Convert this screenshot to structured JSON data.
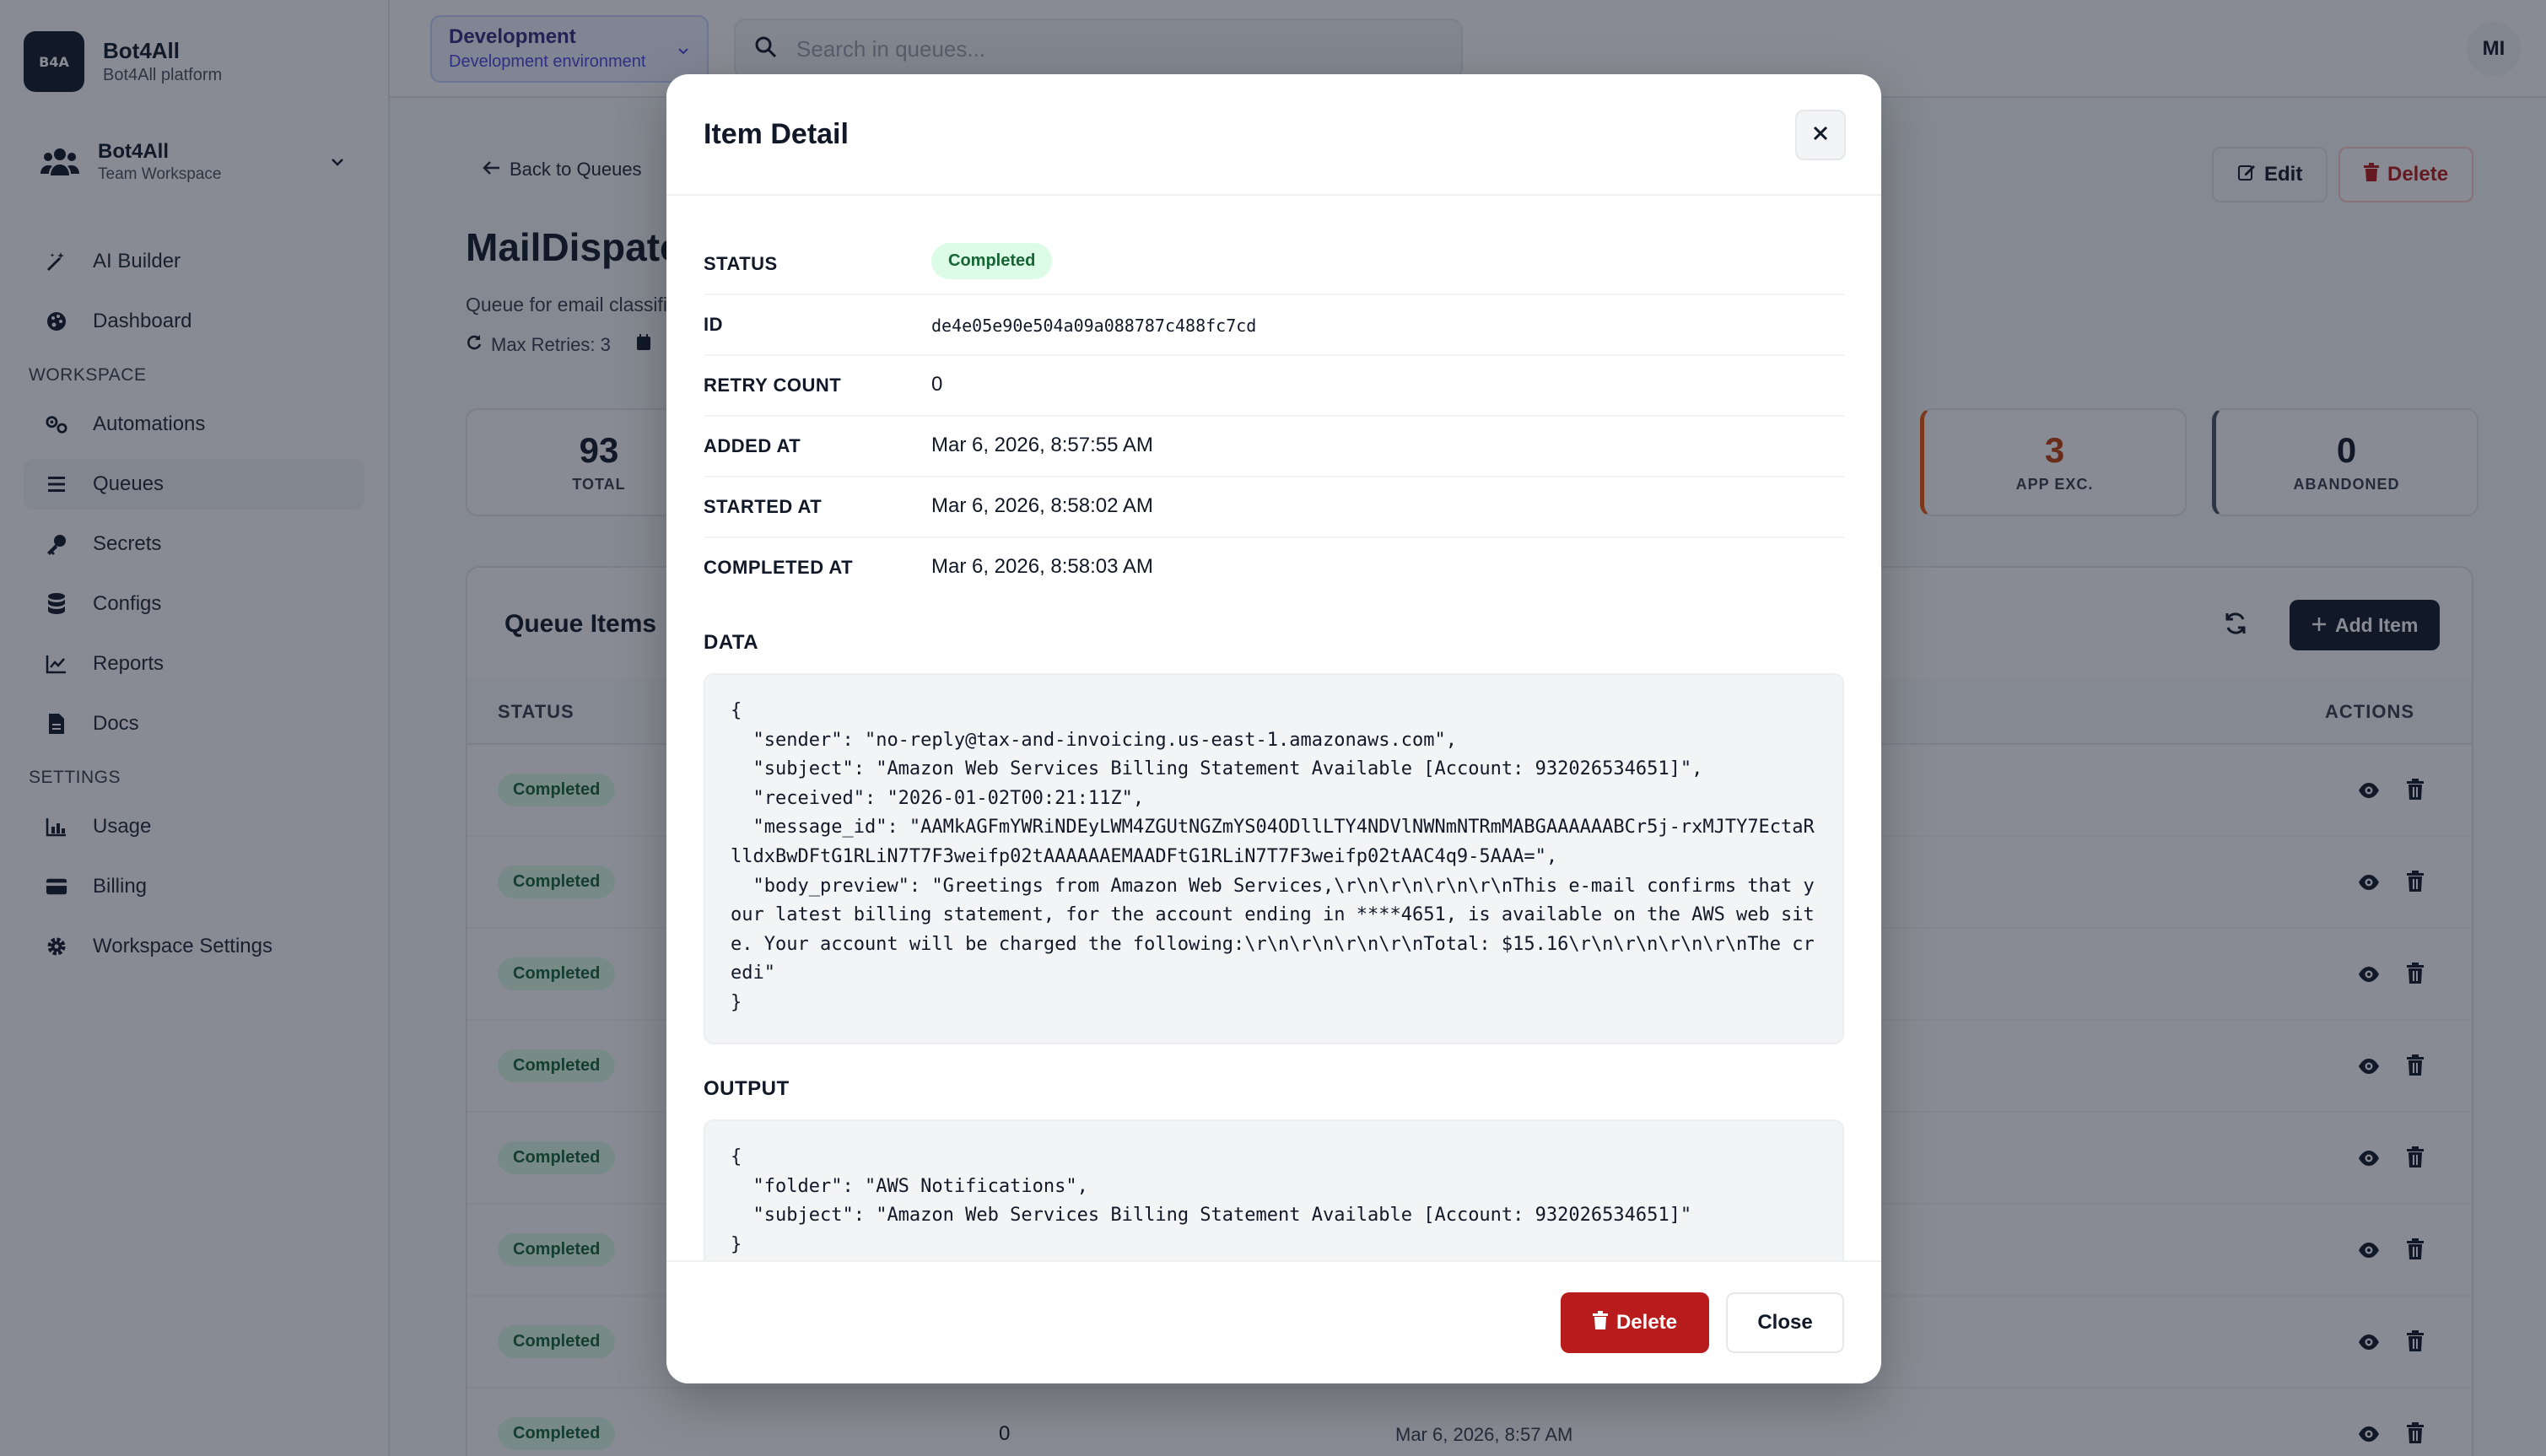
{
  "brand": {
    "logo": "B4A",
    "name": "Bot4All",
    "subtitle": "Bot4All platform"
  },
  "team": {
    "name": "Bot4All",
    "subtitle": "Team Workspace"
  },
  "nav": {
    "top": [
      {
        "label": "AI Builder",
        "icon": "wand-icon"
      },
      {
        "label": "Dashboard",
        "icon": "palette-icon"
      }
    ],
    "workspace_label": "WORKSPACE",
    "workspace": [
      {
        "label": "Automations",
        "icon": "cogs-icon"
      },
      {
        "label": "Queues",
        "icon": "list-icon"
      },
      {
        "label": "Secrets",
        "icon": "key-icon"
      },
      {
        "label": "Configs",
        "icon": "database-icon"
      },
      {
        "label": "Reports",
        "icon": "chart-icon"
      },
      {
        "label": "Docs",
        "icon": "file-icon"
      }
    ],
    "settings_label": "SETTINGS",
    "settings": [
      {
        "label": "Usage",
        "icon": "bar-chart-icon"
      },
      {
        "label": "Billing",
        "icon": "card-icon"
      },
      {
        "label": "Workspace Settings",
        "icon": "gear-icon"
      }
    ]
  },
  "topbar": {
    "env_name": "Development",
    "env_sub": "Development environment",
    "search_placeholder": "Search in queues...",
    "avatar": "MI"
  },
  "page": {
    "back": "Back to Queues",
    "title": "MailDispatcher",
    "description": "Queue for email classification",
    "max_retries": "Max Retries: 3",
    "edit": "Edit",
    "delete": "Delete"
  },
  "stats": [
    {
      "value": "93",
      "label": "TOTAL"
    },
    {
      "value": "3",
      "label": "APP EXC.",
      "color": "#c2410c"
    },
    {
      "value": "0",
      "label": "ABANDONED"
    }
  ],
  "queue": {
    "title": "Queue Items",
    "add": "Add Item",
    "col_status": "STATUS",
    "col_actions": "ACTIONS",
    "rows": [
      {
        "status": "Completed"
      },
      {
        "status": "Completed"
      },
      {
        "status": "Completed"
      },
      {
        "status": "Completed"
      },
      {
        "status": "Completed"
      },
      {
        "status": "Completed"
      },
      {
        "status": "Completed"
      },
      {
        "status": "Completed",
        "retry": "0",
        "date": "Mar 6, 2026, 8:57 AM"
      }
    ]
  },
  "modal": {
    "title": "Item Detail",
    "fields": [
      {
        "key": "STATUS",
        "value": "Completed"
      },
      {
        "key": "ID",
        "value": "de4e05e90e504a09a088787c488fc7cd"
      },
      {
        "key": "RETRY COUNT",
        "value": "0"
      },
      {
        "key": "ADDED AT",
        "value": "Mar 6, 2026, 8:57:55 AM"
      },
      {
        "key": "STARTED AT",
        "value": "Mar 6, 2026, 8:58:02 AM"
      },
      {
        "key": "COMPLETED AT",
        "value": "Mar 6, 2026, 8:58:03 AM"
      }
    ],
    "data_label": "DATA",
    "data_json": "{\n  \"sender\": \"no-reply@tax-and-invoicing.us-east-1.amazonaws.com\",\n  \"subject\": \"Amazon Web Services Billing Statement Available [Account: 932026534651]\",\n  \"received\": \"2026-01-02T00:21:11Z\",\n  \"message_id\": \"AAMkAGFmYWRiNDEyLWM4ZGUtNGZmYS04ODllLTY4NDVlNWNmNTRmMABGAAAAAABCr5j-rxMJTY7EctaRlldxBwDFtG1RLiN7T7F3weifp02tAAAAAAEMAADFtG1RLiN7T7F3weifp02tAAC4q9-5AAA=\",\n  \"body_preview\": \"Greetings from Amazon Web Services,\\r\\n\\r\\n\\r\\n\\r\\nThis e-mail confirms that your latest billing statement, for the account ending in ****4651, is available on the AWS web site. Your account will be charged the following:\\r\\n\\r\\n\\r\\n\\r\\nTotal: $15.16\\r\\n\\r\\n\\r\\n\\r\\nThe credi\"\n}",
    "output_label": "OUTPUT",
    "output_json": "{\n  \"folder\": \"AWS Notifications\",\n  \"subject\": \"Amazon Web Services Billing Statement Available [Account: 932026534651]\"\n}",
    "delete": "Delete",
    "close": "Close"
  }
}
